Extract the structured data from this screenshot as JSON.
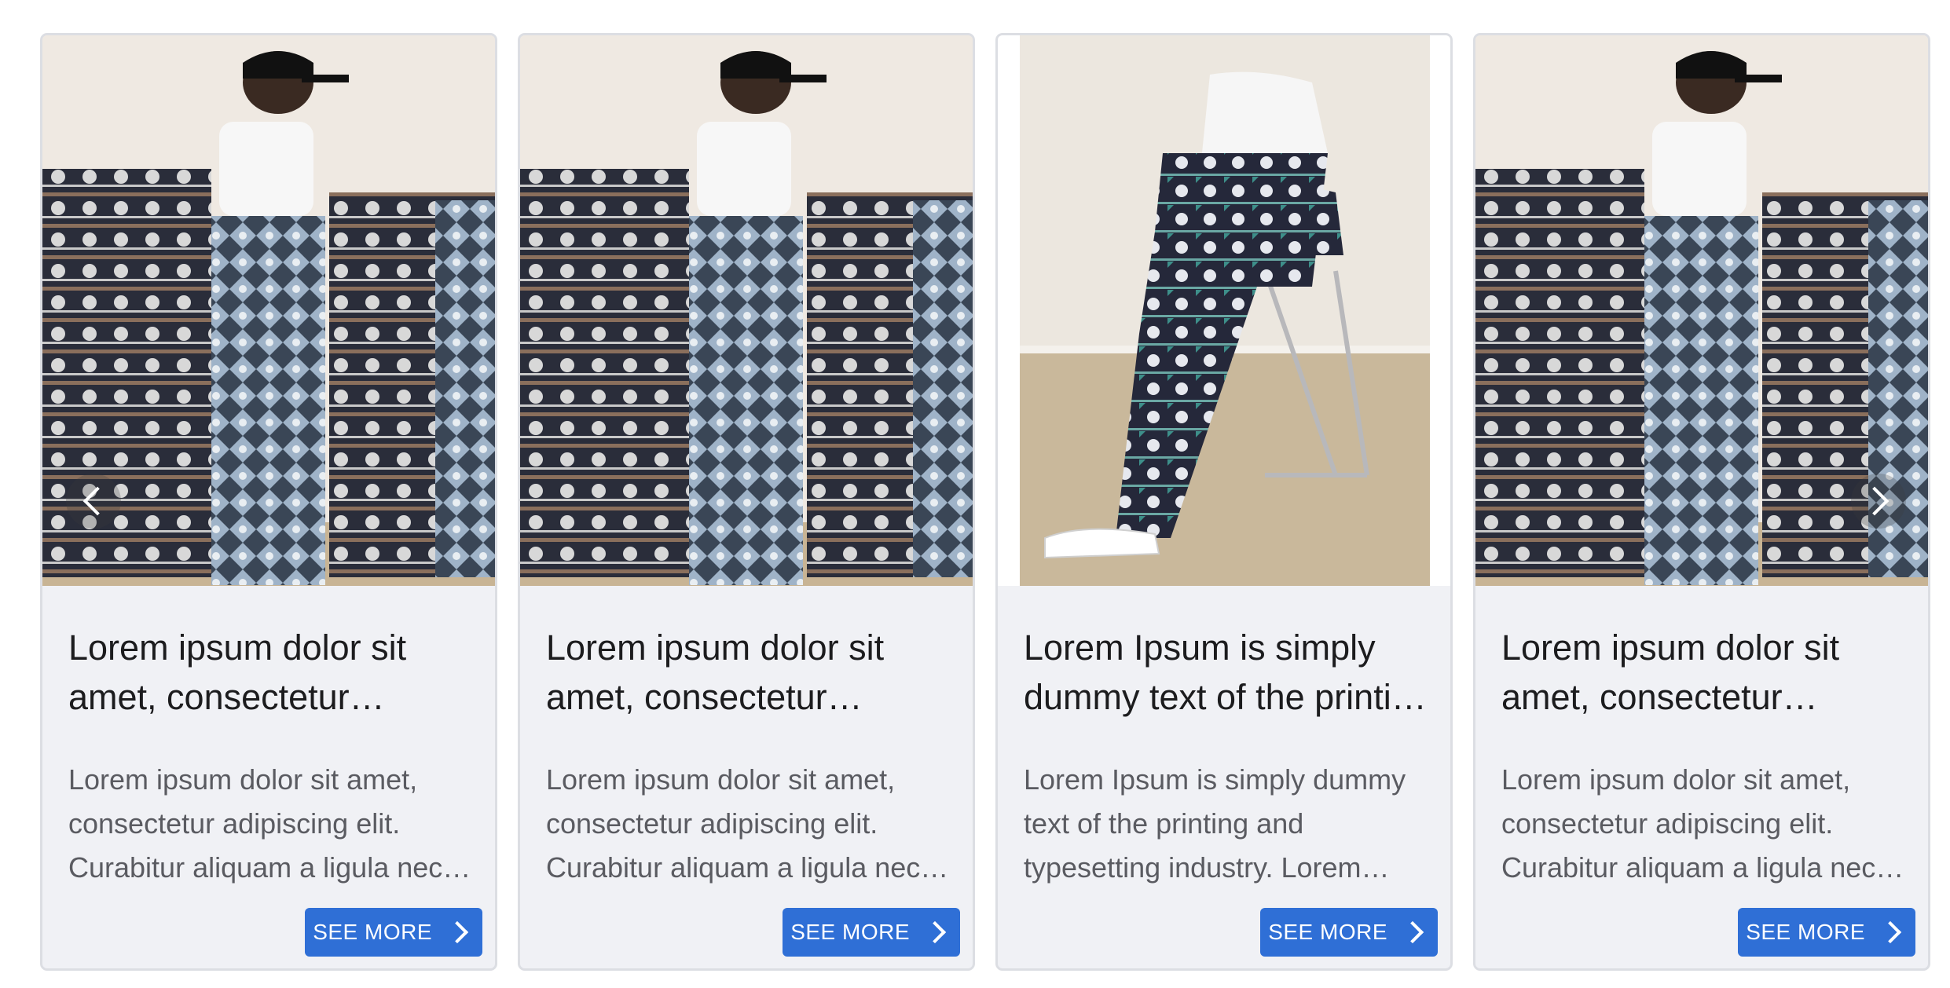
{
  "carousel": {
    "cards": [
      {
        "image_name": "product-photo-pants-rack",
        "title": "Lorem ipsum dolor sit amet, consectetur adipiscing elit.",
        "description": "Lorem ipsum dolor sit amet, consectetur adipiscing elit. Curabitur aliquam a ligula nec dapibus.",
        "button_label": "SEE MORE"
      },
      {
        "image_name": "product-photo-pants-rack",
        "title": "Lorem ipsum dolor sit amet, consectetur adipiscing elit.",
        "description": "Lorem ipsum dolor sit amet, consectetur adipiscing elit. Curabitur aliquam a ligula nec dapibus.",
        "button_label": "SEE MORE"
      },
      {
        "image_name": "product-photo-seated-model",
        "title": "Lorem Ipsum is simply dummy text of the printing industry.",
        "description": "Lorem Ipsum is simply dummy text of the printing and typesetting industry. Lorem Ipsum has been.",
        "button_label": "SEE MORE"
      },
      {
        "image_name": "product-photo-pants-rack",
        "title": "Lorem ipsum dolor sit amet, consectetur adipiscing elit.",
        "description": "Lorem ipsum dolor sit amet, consectetur adipiscing elit. Curabitur aliquam a ligula nec dapibus.",
        "button_label": "SEE MORE"
      }
    ],
    "prev_icon": "chevron-left-icon",
    "next_icon": "chevron-right-icon"
  },
  "colors": {
    "card_background": "#f0f1f5",
    "button_background": "#2f6fd6",
    "title_text": "#1c1c1e",
    "description_text": "#5a5b61"
  }
}
